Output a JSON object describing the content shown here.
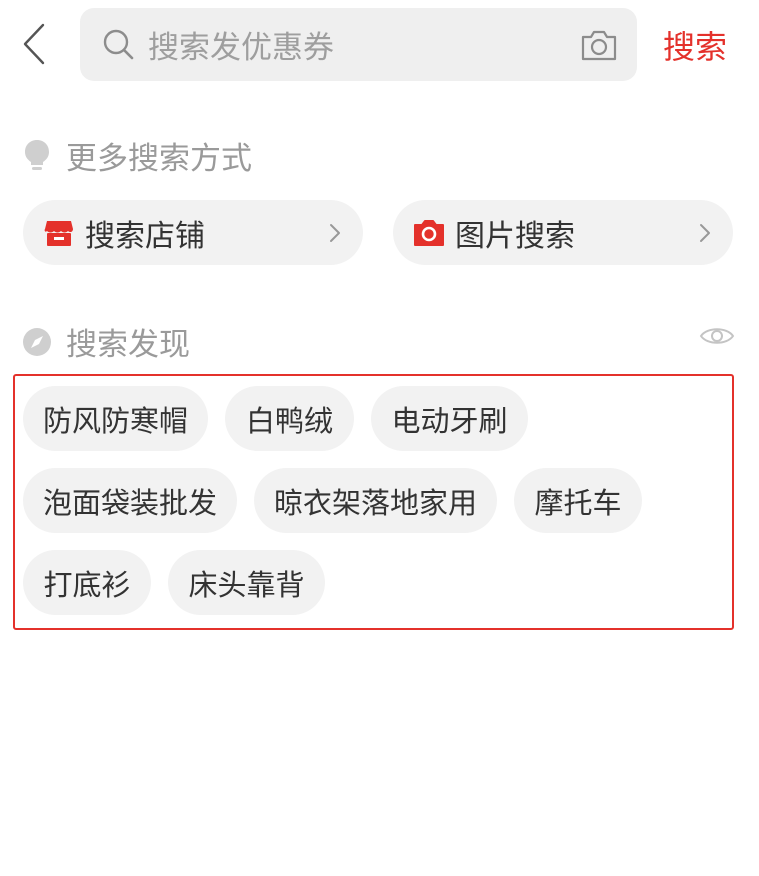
{
  "header": {
    "search_placeholder": "搜索发优惠券",
    "search_button": "搜索"
  },
  "more_search": {
    "title": "更多搜索方式",
    "methods": [
      {
        "label": "搜索店铺",
        "icon": "store-icon"
      },
      {
        "label": "图片搜索",
        "icon": "camera-icon"
      }
    ]
  },
  "discover": {
    "title": "搜索发现",
    "tags": [
      "防风防寒帽",
      "白鸭绒",
      "电动牙刷",
      "泡面袋装批发",
      "晾衣架落地家用",
      "摩托车",
      "打底衫",
      "床头靠背"
    ]
  },
  "colors": {
    "accent": "#e4312b",
    "pill_bg": "#f2f2f2",
    "search_bg": "#efefef",
    "muted_text": "#9a9a9a"
  }
}
